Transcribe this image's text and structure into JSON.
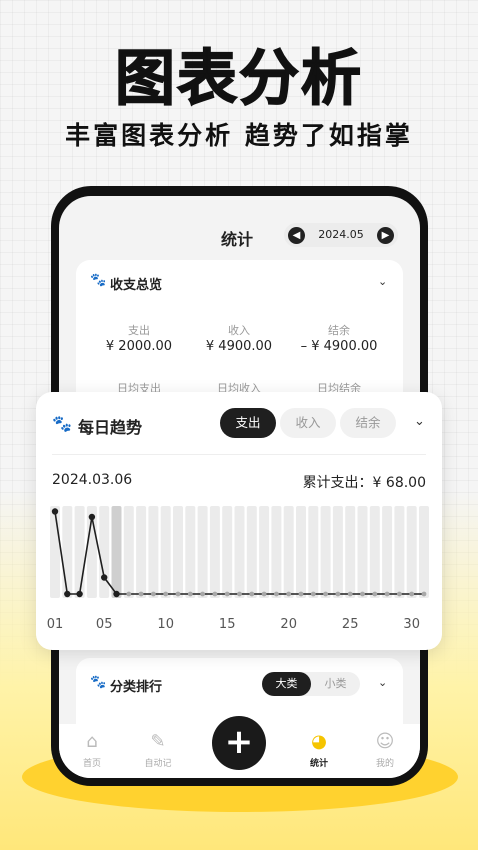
{
  "promo": {
    "headline": "图表分析",
    "subline": "丰富图表分析 趋势了如指掌"
  },
  "header": {
    "title": "统计",
    "month": "2024.05",
    "prev_icon": "chevron-left-icon",
    "next_icon": "chevron-right-icon"
  },
  "overview": {
    "title": "收支总览",
    "stats": [
      {
        "label": "支出",
        "value": "¥ 2000.00"
      },
      {
        "label": "收入",
        "value": "¥ 4900.00"
      },
      {
        "label": "结余",
        "value": "– ¥ 4900.00"
      }
    ],
    "daily": [
      "日均支出",
      "日均收入",
      "日均结余"
    ]
  },
  "trend": {
    "title": "每日趋势",
    "tabs": [
      "支出",
      "收入",
      "结余"
    ],
    "active_tab": "支出",
    "selected_date": "2024.03.06",
    "total_label": "累计支出：¥ 68.00"
  },
  "ranking": {
    "title": "分类排行",
    "toggle": [
      "大类",
      "小类"
    ],
    "active": "大类"
  },
  "tabbar": {
    "items": [
      {
        "label": "首页",
        "icon": "home-icon"
      },
      {
        "label": "自动记",
        "icon": "edit-icon"
      },
      {
        "label": "统计",
        "icon": "pie-chart-icon"
      },
      {
        "label": "我的",
        "icon": "user-icon"
      }
    ],
    "add_icon": "plus-icon"
  },
  "colors": {
    "accent_yellow": "#ffd22f",
    "dark": "#1f1f1f",
    "bar": "#ebebeb",
    "bar_selected": "#cfcfcf"
  },
  "chart_data": {
    "type": "line",
    "title": "",
    "xlabel": "",
    "ylabel": "",
    "x": [
      1,
      2,
      3,
      4,
      5,
      6,
      7,
      8,
      9,
      10,
      11,
      12,
      13,
      14,
      15,
      16,
      17,
      18,
      19,
      20,
      21,
      22,
      23,
      24,
      25,
      26,
      27,
      28,
      29,
      30,
      31
    ],
    "x_tick_labels": [
      "01",
      "05",
      "10",
      "15",
      "20",
      "25",
      "30"
    ],
    "x_tick_values": [
      1,
      5,
      10,
      15,
      20,
      25,
      30
    ],
    "series": [
      {
        "values": [
          30,
          0,
          0,
          28,
          6,
          0,
          0,
          0,
          0,
          0,
          0,
          0,
          0,
          0,
          0,
          0,
          0,
          0,
          0,
          0,
          0,
          0,
          0,
          0,
          0,
          0,
          0,
          0,
          0,
          0,
          0
        ]
      }
    ],
    "selected_index": 5,
    "ylim": [
      0,
      32
    ],
    "grid": false
  }
}
